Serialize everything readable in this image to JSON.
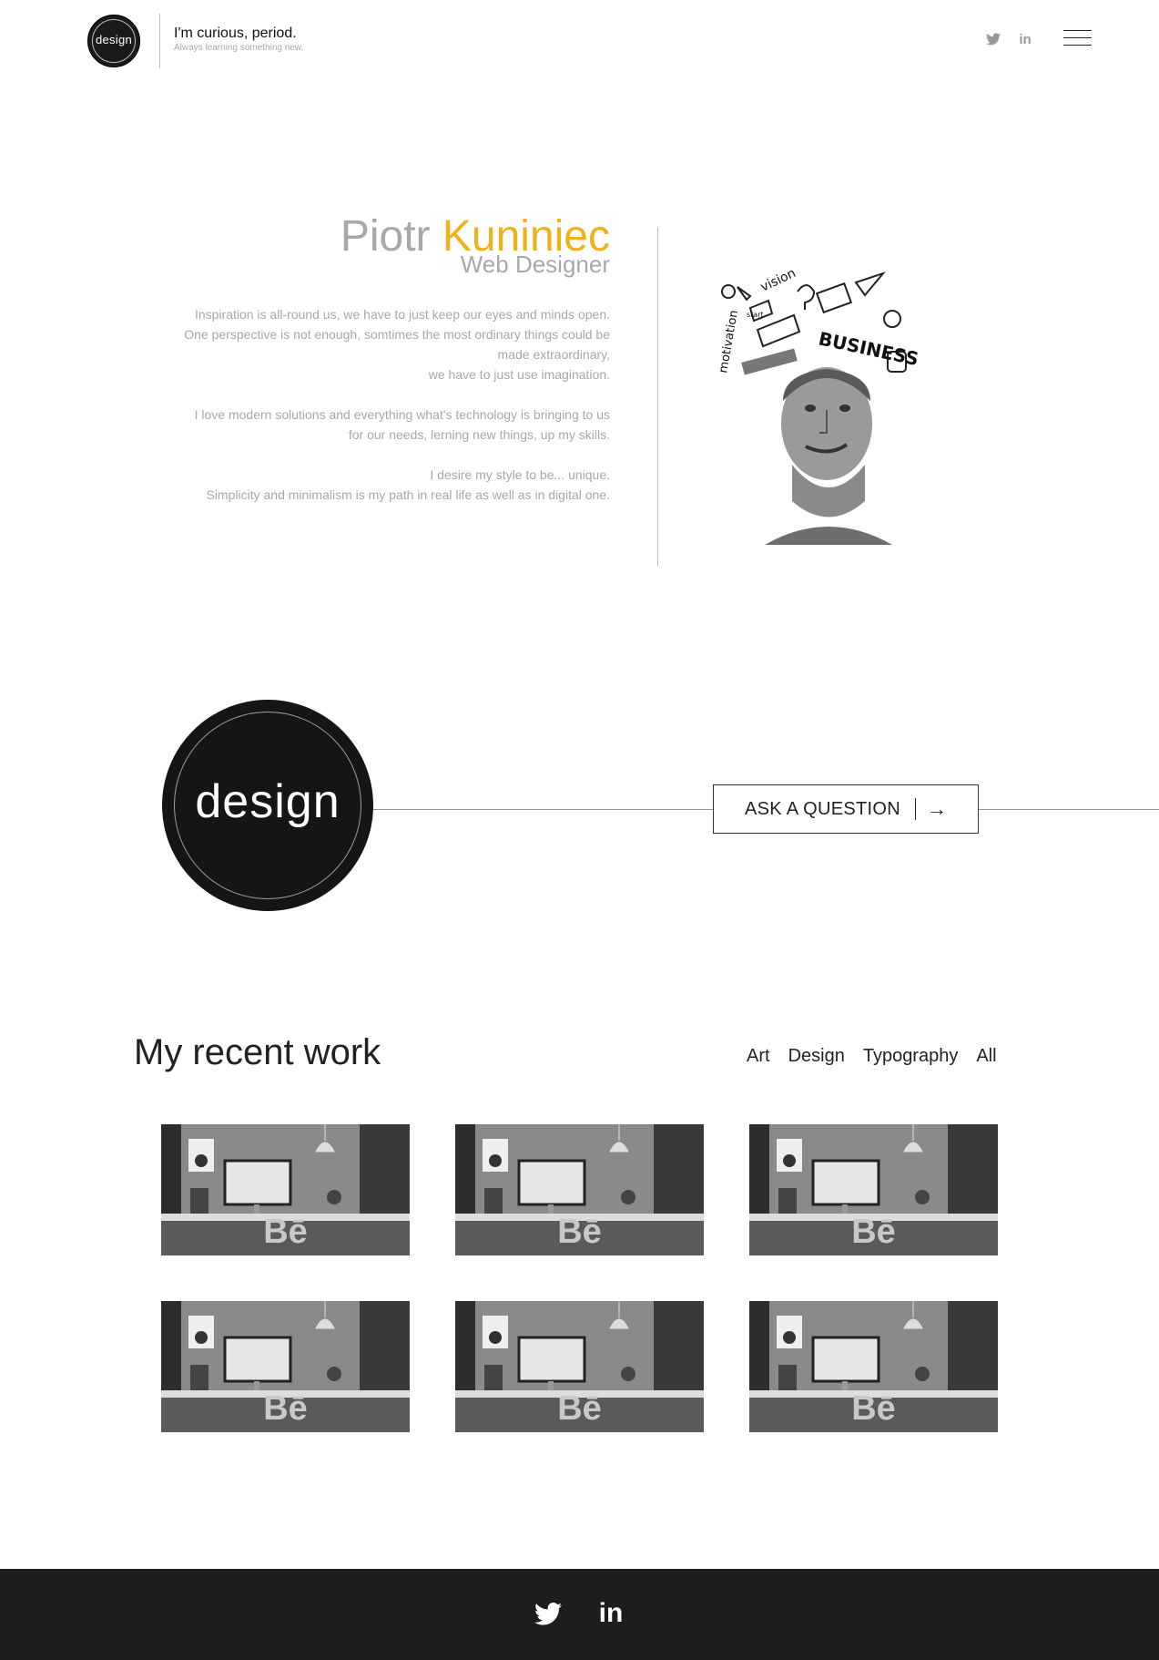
{
  "header": {
    "logo_text": "design",
    "tagline": "I'm curious, period.",
    "subtagline": "Always learning something new.",
    "social": [
      {
        "icon": "twitter-icon"
      },
      {
        "icon": "linkedin-icon",
        "glyph": "in"
      }
    ],
    "menu_icon": "hamburger-menu-icon"
  },
  "intro": {
    "first_name": "Piotr",
    "last_name": "Kuniniec",
    "role": "Web Designer",
    "bio": [
      "Inspiration is all-round us, we have to just keep our eyes and minds open.\nOne perspective is not enough, somtimes the most ordinary things could be made extraordinary,\nwe have to just use imagination.",
      "I love modern solutions and everything what's technology is bringing to us for our needs, lerning new things, up my skills.",
      "I desire my style to be... unique.\nSimplicity and minimalism is my path in real life as well as in digital one."
    ],
    "portrait_words": [
      "vision",
      "motivation",
      "start",
      "BUSINESS"
    ],
    "name_color": "#a8a8a8",
    "accent_color": "#f0b21b"
  },
  "cta": {
    "logo_text": "design",
    "button_label": "ASK A QUESTION",
    "button_arrow": "→"
  },
  "work": {
    "title": "My recent work",
    "filters": [
      "Art",
      "Design",
      "Typography",
      "All"
    ],
    "thumbnails": [
      {
        "badge": "Bē"
      },
      {
        "badge": "Bē"
      },
      {
        "badge": "Bē"
      },
      {
        "badge": "Bē"
      },
      {
        "badge": "Bē"
      },
      {
        "badge": "Bē"
      }
    ]
  },
  "footer": {
    "background": "#1d1d1f",
    "social": [
      {
        "icon": "twitter-icon"
      },
      {
        "icon": "linkedin-icon",
        "glyph": "in"
      }
    ]
  }
}
